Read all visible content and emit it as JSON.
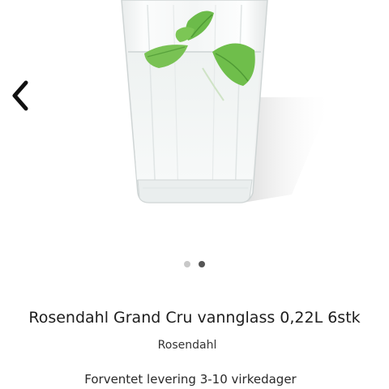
{
  "gallery": {
    "image_alt": "Rosendahl Grand Cru vannglass 0,22L 6stk",
    "prev_icon": "chevron-left-icon",
    "slide_count": 2,
    "active_slide": 2,
    "dot_color_active": "#555555",
    "dot_color_inactive": "#c8c8c8"
  },
  "product": {
    "title": "Rosendahl Grand Cru vannglass 0,22L 6stk",
    "brand": "Rosendahl",
    "delivery": "Forventet levering 3-10 virkedager"
  }
}
